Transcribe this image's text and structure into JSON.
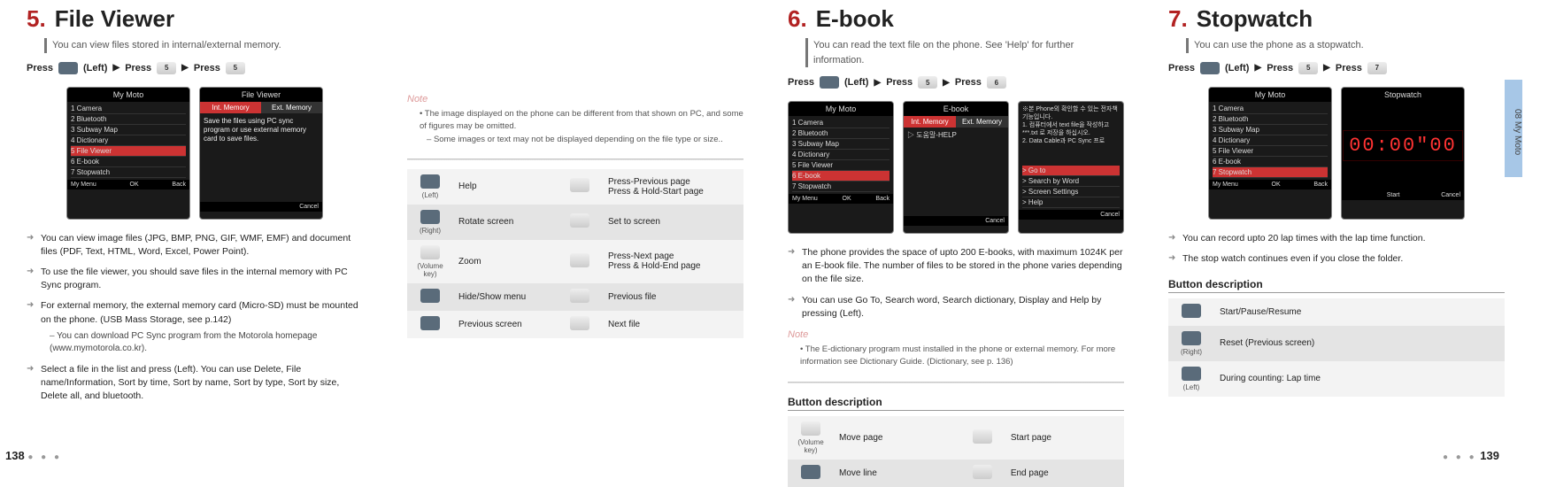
{
  "sidetab": "08  My Moto",
  "page_left": "138",
  "page_right": "139",
  "s5": {
    "num": "5.",
    "title": "File Viewer",
    "sub": "You can view files stored in internal/external memory.",
    "press": {
      "p": "Press",
      "left": "(Left)",
      "k5": "5",
      "arrow": "▶"
    },
    "phone1": {
      "title": "My Moto",
      "items": [
        "1 Camera",
        "2 Bluetooth",
        "3 Subway Map",
        "4 Dictionary",
        "5 File Viewer",
        "6 E-book",
        "7 Stopwatch"
      ],
      "sel": 4,
      "ft": [
        "My Menu",
        "OK",
        "Back"
      ]
    },
    "phone2": {
      "title": "File Viewer",
      "tabs": [
        "Int. Memory",
        "Ext. Memory"
      ],
      "body": "Save the files using PC sync program or use external memory card to save files.",
      "ft": [
        "",
        "",
        "Cancel"
      ]
    },
    "bul": [
      {
        "t": "You can view image files (JPG, BMP, PNG, GIF, WMF, EMF) and document files (PDF, Text, HTML, Word, Excel, Power Point)."
      },
      {
        "t": "To use the file viewer, you should save files in the internal memory with PC Sync program."
      },
      {
        "t": "For external memory, the external memory card (Micro-SD) must be mounted on the phone. (USB Mass Storage, see p.142)",
        "sub": "You can download PC Sync program from the Motorola homepage (www.mymotorola.co.kr)."
      },
      {
        "t": "Select a file in the list and press       (Left). You can use Delete, File name/Information, Sort by time, Sort by name, Sort by type, Sort by size, Delete all, and bluetooth."
      }
    ]
  },
  "s5b": {
    "note": {
      "lbl": "Note",
      "l1": "• The image displayed on the phone can be different from that shown on PC, and some of figures may be omitted.",
      "l2": "Some images or text may not be displayed depending on the file type or size.."
    },
    "rows": [
      {
        "k1": "(Left)",
        "t1": "Help",
        "t2": "Press-Previous page\nPress & Hold-Start page"
      },
      {
        "k1": "(Right)",
        "t1": "Rotate screen",
        "t2": "Set to screen"
      },
      {
        "k1": "(Volume key)",
        "t1": "Zoom",
        "t2": "Press-Next page\nPress & Hold-End page"
      },
      {
        "k1": "",
        "t1": "Hide/Show menu",
        "t2": "Previous file"
      },
      {
        "k1": "",
        "t1": "Previous screen",
        "t2": "Next file"
      }
    ]
  },
  "s6": {
    "num": "6.",
    "title": "E-book",
    "sub": "You can read the text file on the phone. See 'Help' for further information.",
    "press": {
      "p": "Press",
      "left": "(Left)",
      "k5": "5",
      "k6": "6",
      "arrow": "▶"
    },
    "phone1": {
      "title": "My Moto",
      "items": [
        "1 Camera",
        "2 Bluetooth",
        "3 Subway Map",
        "4 Dictionary",
        "5 File Viewer",
        "6 E-book",
        "7 Stopwatch"
      ],
      "sel": 5,
      "ft": [
        "My Menu",
        "OK",
        "Back"
      ]
    },
    "phone2": {
      "title": "E-book",
      "tabs": [
        "Int. Memory",
        "Ext. Memory"
      ],
      "body": "▷ 도움말-HELP",
      "ft": [
        "",
        "",
        "Cancel"
      ]
    },
    "phone3": {
      "title": "",
      "body": "※본 Phone외 확인할 수 있는 전자책 기능입니다.\n1. 컴퓨터에서 text file을 작성하고 ***.txt 로 저장을 하십시오.\n2. Data Cable과 PC Sync 프로",
      "items": [
        "> Go to",
        "> Search by Word",
        "> Screen Settings",
        "> Help"
      ],
      "ft": [
        "",
        "",
        "Cancel"
      ]
    },
    "bul": [
      {
        "t": "The phone provides the space of upto 200 E-books, with maximum 1024K per an E-book file. The number of files to be stored in the phone varies depending on the file size."
      },
      {
        "t": "You can use Go To, Search word, Search dictionary, Display and Help by pressing        (Left)."
      }
    ],
    "note": {
      "lbl": "Note",
      "l1": "• The E-dictionary program must installed in the phone or external memory. For more information see Dictionary Guide. (Dictionary, see p. 136)"
    },
    "bd": {
      "h": "Button description",
      "rows": [
        {
          "k1": "(Volume key)",
          "t1": "Move page",
          "t2": "Start page"
        },
        {
          "k1": "",
          "t1": "Move line",
          "t2": "End page"
        }
      ]
    }
  },
  "s7": {
    "num": "7.",
    "title": "Stopwatch",
    "sub": "You can use the phone as a stopwatch.",
    "press": {
      "p": "Press",
      "left": "(Left)",
      "k5": "5",
      "k7": "7",
      "arrow": "▶"
    },
    "phone1": {
      "title": "My Moto",
      "items": [
        "1 Camera",
        "2 Bluetooth",
        "3 Subway Map",
        "4 Dictionary",
        "5 File Viewer",
        "6 E-book",
        "7 Stopwatch"
      ],
      "sel": 6,
      "ft": [
        "My Menu",
        "OK",
        "Back"
      ]
    },
    "phone2": {
      "title": "Stopwatch",
      "digits": "00:00\"00",
      "ft": [
        "",
        "Start",
        "Cancel"
      ]
    },
    "bul": [
      {
        "t": "You can record upto 20 lap times with the lap time function."
      },
      {
        "t": "The stop watch continues even if you close the folder."
      }
    ],
    "bd": {
      "h": "Button description",
      "rows": [
        {
          "k1": "",
          "t1": "Start/Pause/Resume"
        },
        {
          "k1": "(Right)",
          "t1": "Reset (Previous screen)"
        },
        {
          "k1": "(Left)",
          "t1": "During counting: Lap time"
        }
      ]
    }
  }
}
